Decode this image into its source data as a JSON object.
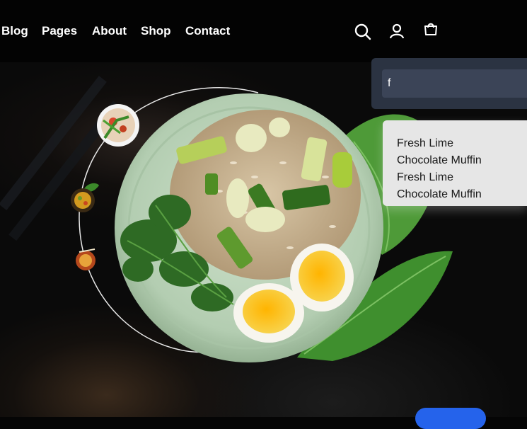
{
  "nav": {
    "links": [
      {
        "label": "Blog"
      },
      {
        "label": "Pages"
      },
      {
        "label": "About"
      },
      {
        "label": "Shop"
      },
      {
        "label": "Contact"
      }
    ],
    "icons": [
      "search-icon",
      "user-icon",
      "shopping-bag-icon"
    ]
  },
  "search": {
    "value": "f",
    "suggestions": [
      {
        "label": "Fresh Lime"
      },
      {
        "label": "Chocolate Muffin"
      },
      {
        "label": "Fresh Lime"
      },
      {
        "label": "Chocolate Muffin"
      }
    ]
  },
  "carousel": {
    "thumbnails": [
      "salad-bowl-thumbnail",
      "curry-bowl-thumbnail",
      "noodle-bowl-thumbnail"
    ]
  },
  "colors": {
    "nav_bg": "#030303",
    "search_panel": "#2b3342",
    "search_input": "#3b4457",
    "dropdown_bg": "#e6e6e6",
    "cta_blue": "#2563eb",
    "plate": "#b9d2b8",
    "leaf": "#3f8f2e",
    "yolk": "#f6b21b"
  }
}
